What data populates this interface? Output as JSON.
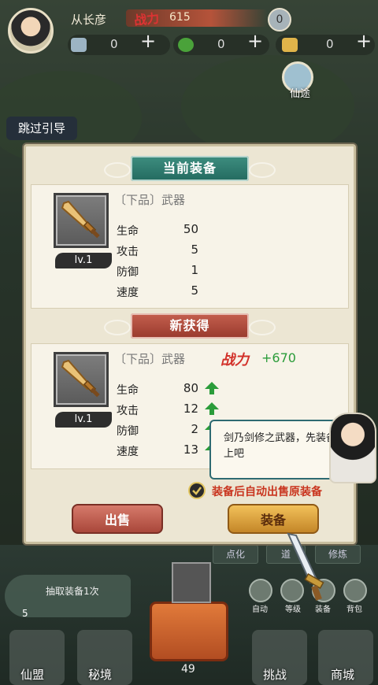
{
  "hud": {
    "player_name": "从长彦",
    "power_label": "战力",
    "power_value": "615",
    "level_badge": "0",
    "resource_1": "0",
    "resource_2": "0",
    "resource_3": "0",
    "side_button_label": "仙途",
    "skip_guide": "跳过引导"
  },
  "dialog": {
    "current_title": "当前装备",
    "new_title": "新获得",
    "current_item": {
      "name": "〔下品〕武器",
      "level": "lv.1",
      "stats": [
        {
          "label": "生命",
          "value": "50"
        },
        {
          "label": "攻击",
          "value": "5"
        },
        {
          "label": "防御",
          "value": "1"
        },
        {
          "label": "速度",
          "value": "5"
        }
      ]
    },
    "new_item": {
      "name": "〔下品〕武器",
      "level": "lv.1",
      "power_label": "战力",
      "power_gain": "+670",
      "stats": [
        {
          "label": "生命",
          "value": "80"
        },
        {
          "label": "攻击",
          "value": "12"
        },
        {
          "label": "防御",
          "value": "2"
        },
        {
          "label": "速度",
          "value": "13"
        }
      ]
    },
    "auto_equip_text": "装备后自动出售原装备",
    "sell_button": "出售",
    "equip_button": "装备"
  },
  "tooltip": {
    "text": "剑乃剑修之武器，先装备上吧"
  },
  "bottom": {
    "tabs": [
      "点化",
      "道",
      "修炼"
    ],
    "draw_label": "抽取装备1次",
    "draw_count": "5",
    "round_buttons": [
      "自动",
      "等级",
      "装备",
      "背包"
    ],
    "chest_count": "49",
    "nav": [
      "仙盟",
      "秘境",
      "挑战",
      "商城"
    ]
  },
  "colors": {
    "accent_green": "#2b9c3a",
    "accent_red": "#c9351f",
    "ribbon_green": "#2f7d70",
    "ribbon_red": "#b24b3c",
    "equip_gold": "#e3ab43"
  }
}
